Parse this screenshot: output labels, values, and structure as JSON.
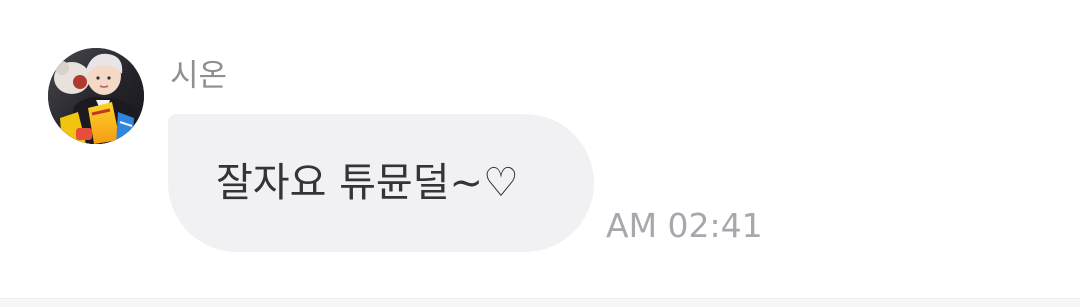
{
  "message": {
    "sender_name": "시온",
    "avatar_icon": "profile-photo",
    "text": "잘자요 튜뮨덜~♡",
    "time": "AM 02:41"
  },
  "colors": {
    "background": "#ffffff",
    "bubble": "#f1f1f3",
    "sender_name": "#8e8e93",
    "message_text": "#333338",
    "timestamp": "#a7a7ad"
  }
}
